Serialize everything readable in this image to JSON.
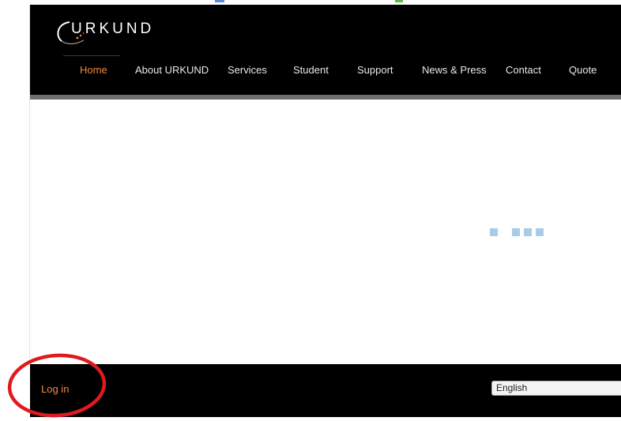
{
  "header": {
    "logo_text": "URKUND",
    "nav": [
      {
        "label": "Home",
        "active": true
      },
      {
        "label": "About URKUND",
        "active": false
      },
      {
        "label": "Services",
        "active": false
      },
      {
        "label": "Student",
        "active": false
      },
      {
        "label": "Support",
        "active": false
      },
      {
        "label": "News & Press",
        "active": false
      },
      {
        "label": "Contact",
        "active": false
      },
      {
        "label": "Quote",
        "active": false
      }
    ]
  },
  "footer": {
    "login_label": "Log in",
    "language_selected": "English"
  },
  "colors": {
    "accent": "#f2883a",
    "header_bg": "#000000",
    "loader": "#a9cbe8",
    "annotation": "#e0191f"
  }
}
